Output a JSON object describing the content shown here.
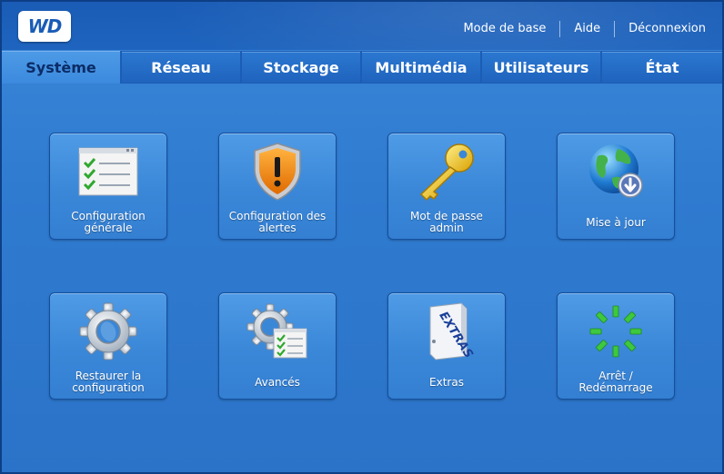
{
  "brand": {
    "logo_text": "WD"
  },
  "top_nav": {
    "basic_mode": "Mode de base",
    "help": "Aide",
    "logout": "Déconnexion"
  },
  "tabs": [
    {
      "label": "Système",
      "active": true
    },
    {
      "label": "Réseau",
      "active": false
    },
    {
      "label": "Stockage",
      "active": false
    },
    {
      "label": "Multimédia",
      "active": false
    },
    {
      "label": "Utilisateurs",
      "active": false
    },
    {
      "label": "État",
      "active": false
    }
  ],
  "tiles": [
    {
      "line1": "Configuration",
      "line2": "générale",
      "icon": "checklist-icon"
    },
    {
      "line1": "Configuration des",
      "line2": "alertes",
      "icon": "alert-shield-icon"
    },
    {
      "line1": "Mot de passe",
      "line2": "admin",
      "icon": "key-icon"
    },
    {
      "line1": "Mise à jour",
      "line2": "",
      "icon": "globe-download-icon"
    },
    {
      "line1": "Restaurer la",
      "line2": "configuration",
      "icon": "gear-icon"
    },
    {
      "line1": "Avancés",
      "line2": "",
      "icon": "gear-checklist-icon"
    },
    {
      "line1": "Extras",
      "line2": "",
      "icon": "extras-box-icon"
    },
    {
      "line1": "Arrêt /",
      "line2": "Redémarrage",
      "icon": "power-spinner-icon"
    }
  ],
  "icon_texts": {
    "extras_box": "EXTRAS"
  },
  "colors": {
    "background": "#2f7bd0",
    "header": "#1a5cb6",
    "tile": "#3a87d8",
    "active_tab_text": "#0b2c66",
    "alert_orange": "#f08a12",
    "key_gold": "#f0c020",
    "spinner_green": "#3ec83e"
  }
}
